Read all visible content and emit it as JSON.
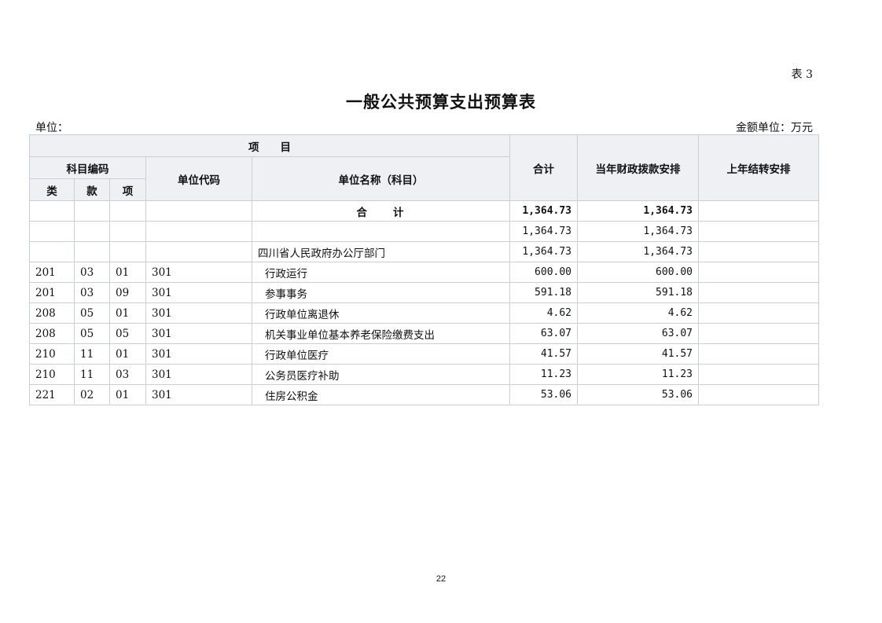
{
  "table_label": "表 3",
  "title": "一般公共预算支出预算表",
  "unit_left": "单位：",
  "unit_right": "金额单位：万元",
  "headers": {
    "project": "项　　目",
    "subject_code": "科目编码",
    "category": "类",
    "section": "款",
    "item": "项",
    "unit_code": "单位代码",
    "unit_name": "单位名称（科目）",
    "total": "合计",
    "current_year": "当年财政拨款安排",
    "last_year": "上年结转安排"
  },
  "total_row": {
    "label": "合　　计",
    "total": "1,364.73",
    "current_year": "1,364.73",
    "last_year": ""
  },
  "rows": [
    {
      "category": "",
      "section": "",
      "item": "",
      "unit_code": "",
      "unit_name": "",
      "total": "1,364.73",
      "current_year": "1,364.73",
      "last_year": ""
    },
    {
      "category": "",
      "section": "",
      "item": "",
      "unit_code": "",
      "unit_name": "四川省人民政府办公厅部门",
      "total": "1,364.73",
      "current_year": "1,364.73",
      "last_year": ""
    },
    {
      "category": "201",
      "section": "03",
      "item": "01",
      "unit_code": "301",
      "unit_name": "行政运行",
      "total": "600.00",
      "current_year": "600.00",
      "last_year": ""
    },
    {
      "category": "201",
      "section": "03",
      "item": "09",
      "unit_code": "301",
      "unit_name": "参事事务",
      "total": "591.18",
      "current_year": "591.18",
      "last_year": ""
    },
    {
      "category": "208",
      "section": "05",
      "item": "01",
      "unit_code": "301",
      "unit_name": "行政单位离退休",
      "total": "4.62",
      "current_year": "4.62",
      "last_year": ""
    },
    {
      "category": "208",
      "section": "05",
      "item": "05",
      "unit_code": "301",
      "unit_name": "机关事业单位基本养老保险缴费支出",
      "total": "63.07",
      "current_year": "63.07",
      "last_year": ""
    },
    {
      "category": "210",
      "section": "11",
      "item": "01",
      "unit_code": "301",
      "unit_name": "行政单位医疗",
      "total": "41.57",
      "current_year": "41.57",
      "last_year": ""
    },
    {
      "category": "210",
      "section": "11",
      "item": "03",
      "unit_code": "301",
      "unit_name": "公务员医疗补助",
      "total": "11.23",
      "current_year": "11.23",
      "last_year": ""
    },
    {
      "category": "221",
      "section": "02",
      "item": "01",
      "unit_code": "301",
      "unit_name": "住房公积金",
      "total": "53.06",
      "current_year": "53.06",
      "last_year": ""
    }
  ],
  "page_number": "22"
}
